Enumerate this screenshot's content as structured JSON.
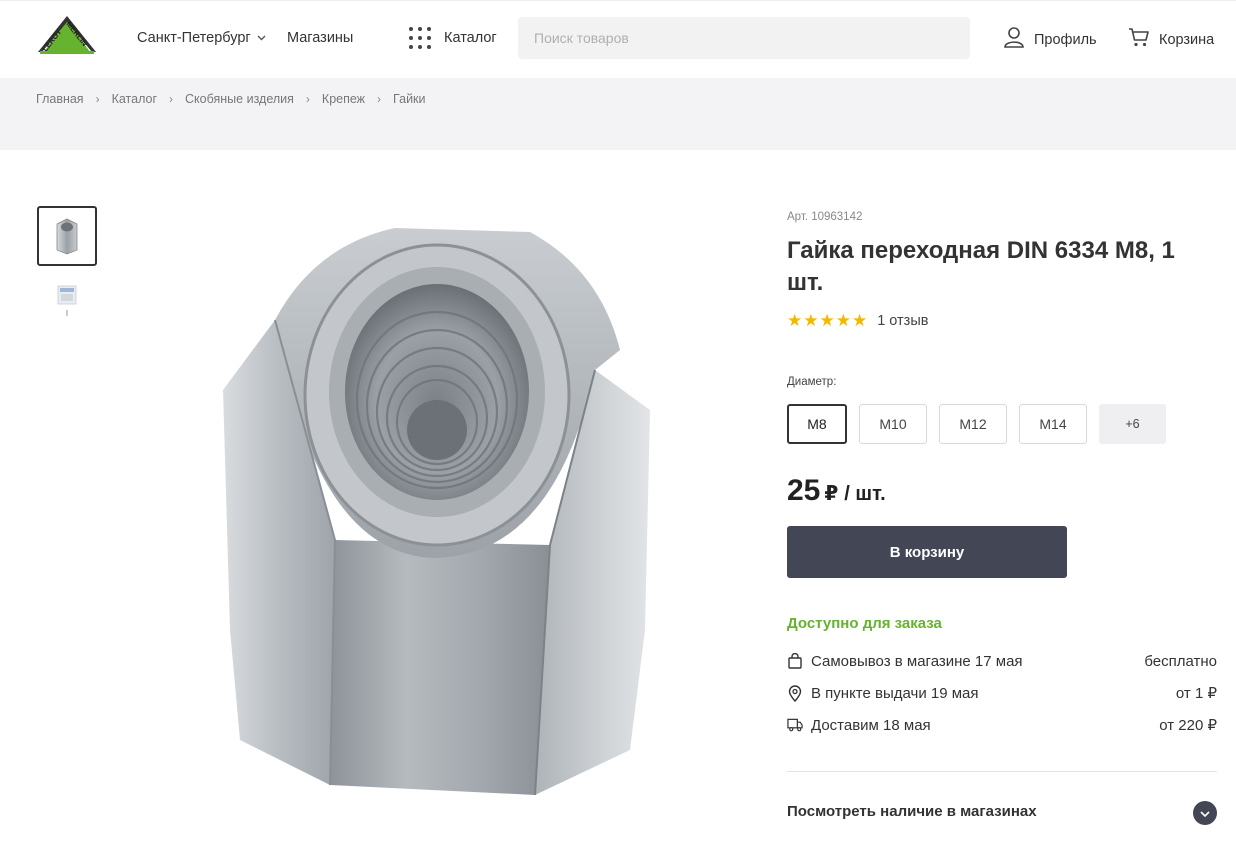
{
  "header": {
    "logo_text_top": "LEROY",
    "logo_text_right": "MERLIN",
    "city": "Санкт-Петербург",
    "stores": "Магазины",
    "catalog": "Каталог",
    "search_placeholder": "Поиск товаров",
    "profile": "Профиль",
    "cart": "Корзина"
  },
  "breadcrumbs": [
    "Главная",
    "Каталог",
    "Скобяные изделия",
    "Крепеж",
    "Гайки"
  ],
  "product": {
    "article": "Арт. 10963142",
    "title": "Гайка переходная DIN 6334 M8, 1 шт.",
    "stars": "★★★★★",
    "rating": 5,
    "reviews": "1 отзыв",
    "diameter_label": "Диаметр:",
    "sizes": [
      {
        "label": "M8",
        "selected": true
      },
      {
        "label": "M10",
        "selected": false
      },
      {
        "label": "M12",
        "selected": false
      },
      {
        "label": "M14",
        "selected": false
      },
      {
        "label": "+6",
        "selected": false
      }
    ],
    "price": "25",
    "currency": "₽",
    "unit": "/ шт.",
    "buy_label": "В корзину",
    "availability": "Доступно для заказа",
    "delivery": [
      {
        "icon": "shopping-bag-icon",
        "text": "Самовывоз в магазине 17 мая",
        "price": "бесплатно"
      },
      {
        "icon": "map-pin-icon",
        "text": "В пункте выдачи 19 мая",
        "price": "от 1 ₽"
      },
      {
        "icon": "truck-icon",
        "text": "Доставим 18 мая",
        "price": "от 220 ₽"
      }
    ],
    "stock_link": "Посмотреть наличие в магазинах"
  },
  "colors": {
    "brand_green": "#65b32e",
    "button_dark": "#434655",
    "star": "#f5b800"
  }
}
